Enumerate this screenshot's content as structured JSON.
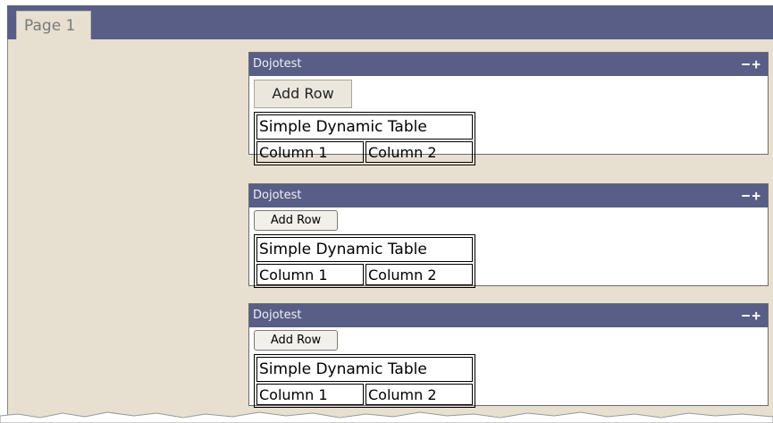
{
  "tabs": [
    {
      "label": "Page 1",
      "active": true
    }
  ],
  "panels": [
    {
      "title": "Dojotest",
      "controls": "−+",
      "button_label": "Add Row",
      "table": {
        "caption": "Simple Dynamic Table",
        "columns": [
          "Column 1",
          "Column 2"
        ]
      }
    },
    {
      "title": "Dojotest",
      "controls": "−+",
      "button_label": "Add Row",
      "table": {
        "caption": "Simple Dynamic Table",
        "columns": [
          "Column 1",
          "Column 2"
        ]
      }
    },
    {
      "title": "Dojotest",
      "controls": "−+",
      "button_label": "Add Row",
      "table": {
        "caption": "Simple Dynamic Table",
        "columns": [
          "Column 1",
          "Column 2"
        ]
      }
    }
  ],
  "colors": {
    "titlebar": "#585e85",
    "background": "#e7dfd0"
  }
}
